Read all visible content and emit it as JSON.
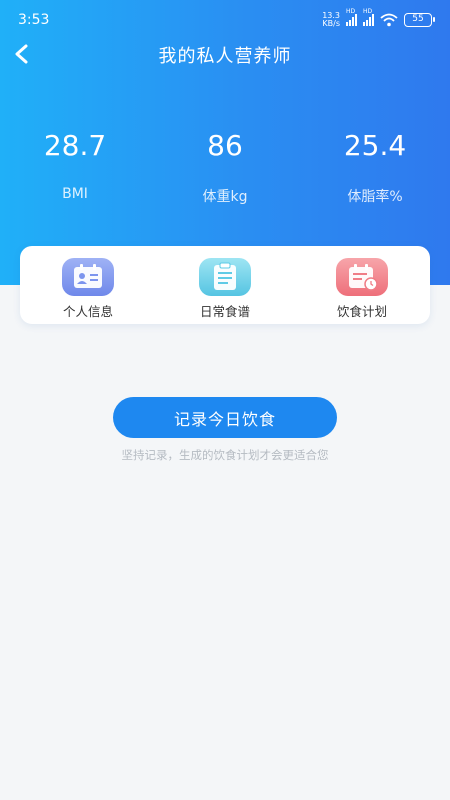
{
  "status_bar": {
    "time": "3:53",
    "net_speed_value": "13.3",
    "net_speed_unit": "KB/s",
    "hd_label_1": "HD",
    "hd_label_2": "HD",
    "battery": "55"
  },
  "header": {
    "title": "我的私人营养师",
    "back_icon": "chevron-left-icon"
  },
  "stats": [
    {
      "value": "28.7",
      "label": "BMI"
    },
    {
      "value": "86",
      "label": "体重kg"
    },
    {
      "value": "25.4",
      "label": "体脂率%"
    }
  ],
  "menu": [
    {
      "label": "个人信息",
      "icon": "id-card-icon",
      "color": "#7c94ee"
    },
    {
      "label": "日常食谱",
      "icon": "clipboard-icon",
      "color": "#5ecbe6"
    },
    {
      "label": "饮食计划",
      "icon": "calendar-clock-icon",
      "color": "#f07d86"
    }
  ],
  "record_button": "记录今日饮食",
  "hint": "坚持记录，生成的饮食计划才会更适合您",
  "colors": {
    "primary": "#1e88f0",
    "gradient_start": "#20b0f8",
    "gradient_end": "#2f79ee"
  }
}
